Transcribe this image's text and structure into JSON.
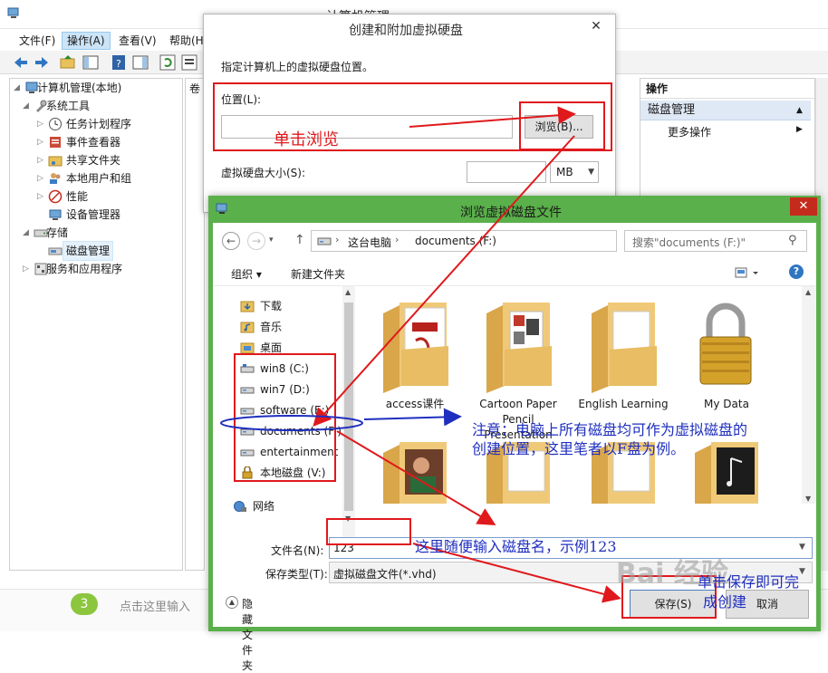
{
  "computer_management": {
    "title": "计算机管理",
    "menu": [
      "文件(F)",
      "操作(A)",
      "查看(V)",
      "帮助(H)"
    ],
    "tree": [
      {
        "label": "计算机管理(本地)",
        "level": 0,
        "expanded": true
      },
      {
        "label": "系统工具",
        "level": 1,
        "expanded": true
      },
      {
        "label": "任务计划程序",
        "level": 2
      },
      {
        "label": "事件查看器",
        "level": 2
      },
      {
        "label": "共享文件夹",
        "level": 2
      },
      {
        "label": "本地用户和组",
        "level": 2
      },
      {
        "label": "性能",
        "level": 2
      },
      {
        "label": "设备管理器",
        "level": 2
      },
      {
        "label": "存储",
        "level": 1,
        "expanded": true
      },
      {
        "label": "磁盘管理",
        "level": 2,
        "selected": true
      },
      {
        "label": "服务和应用程序",
        "level": 1
      }
    ],
    "center_header": "卷",
    "actions": {
      "header": "操作",
      "section": "磁盘管理",
      "more": "更多操作"
    }
  },
  "bottom_strip": {
    "step_number": "3",
    "placeholder": "点击这里输入"
  },
  "create_vhd_dialog": {
    "title": "创建和附加虚拟硬盘",
    "description": "指定计算机上的虚拟硬盘位置。",
    "location_label": "位置(L):",
    "location_value": "",
    "browse_label": "浏览(B)...",
    "size_label": "虚拟硬盘大小(S):",
    "size_value": "",
    "size_unit": "MB"
  },
  "browse_dialog": {
    "title": "浏览虚拟磁盘文件",
    "close_label": "✕",
    "address": {
      "segments": [
        "这台电脑",
        "documents (F:)"
      ]
    },
    "search_placeholder": "搜索\"documents (F:)\"",
    "toolbar": {
      "organize": "组织 ▾",
      "new_folder": "新建文件夹"
    },
    "nav_items": [
      {
        "label": "下载",
        "icon": "download-folder-icon"
      },
      {
        "label": "音乐",
        "icon": "music-folder-icon"
      },
      {
        "label": "桌面",
        "icon": "desktop-folder-icon"
      },
      {
        "label": "win8 (C:)",
        "icon": "windows-drive-icon"
      },
      {
        "label": "win7 (D:)",
        "icon": "drive-icon"
      },
      {
        "label": "software (E:)",
        "icon": "drive-icon"
      },
      {
        "label": "documents (F:)",
        "icon": "drive-icon",
        "selected": true
      },
      {
        "label": "entertainment (",
        "icon": "drive-icon"
      },
      {
        "label": "本地磁盘 (V:)",
        "icon": "locked-drive-icon"
      },
      {
        "label": "网络",
        "icon": "network-icon"
      }
    ],
    "folders": [
      {
        "name": "access课件",
        "icon": "folder-with-pdf-icon"
      },
      {
        "name": "Cartoon Paper Pencil Presentation",
        "icon": "folder-with-documents-icon"
      },
      {
        "name": "English Learning",
        "icon": "folder-icon"
      },
      {
        "name": "My Data",
        "icon": "padlock-icon"
      },
      {
        "name": "",
        "icon": "folder-with-photo-icon"
      },
      {
        "name": "",
        "icon": "folder-icon"
      },
      {
        "name": "",
        "icon": "folder-icon"
      },
      {
        "name": "",
        "icon": "folder-with-dark-image-icon"
      }
    ],
    "filename_label": "文件名(N):",
    "filename_value": "123",
    "filetype_label": "保存类型(T):",
    "filetype_value": "虚拟磁盘文件(*.vhd)",
    "hide_folders": "隐藏文件夹",
    "save": "保存(S)",
    "cancel": "取消"
  },
  "annotations": {
    "click_browse": "单击浏览",
    "note_line1": "注意：电脑上所有磁盘均可作为虚拟磁盘的",
    "note_line2": "创建位置，这里笔者以F盘为例。",
    "name_hint": "这里随便输入磁盘名，示例123",
    "save_hint_line1": "单击保存即可完",
    "save_hint_line2": "成创建",
    "annotation_color_red": "#e0191c",
    "annotation_color_blue": "#1f2fbf"
  },
  "watermark": "Bai 经验"
}
